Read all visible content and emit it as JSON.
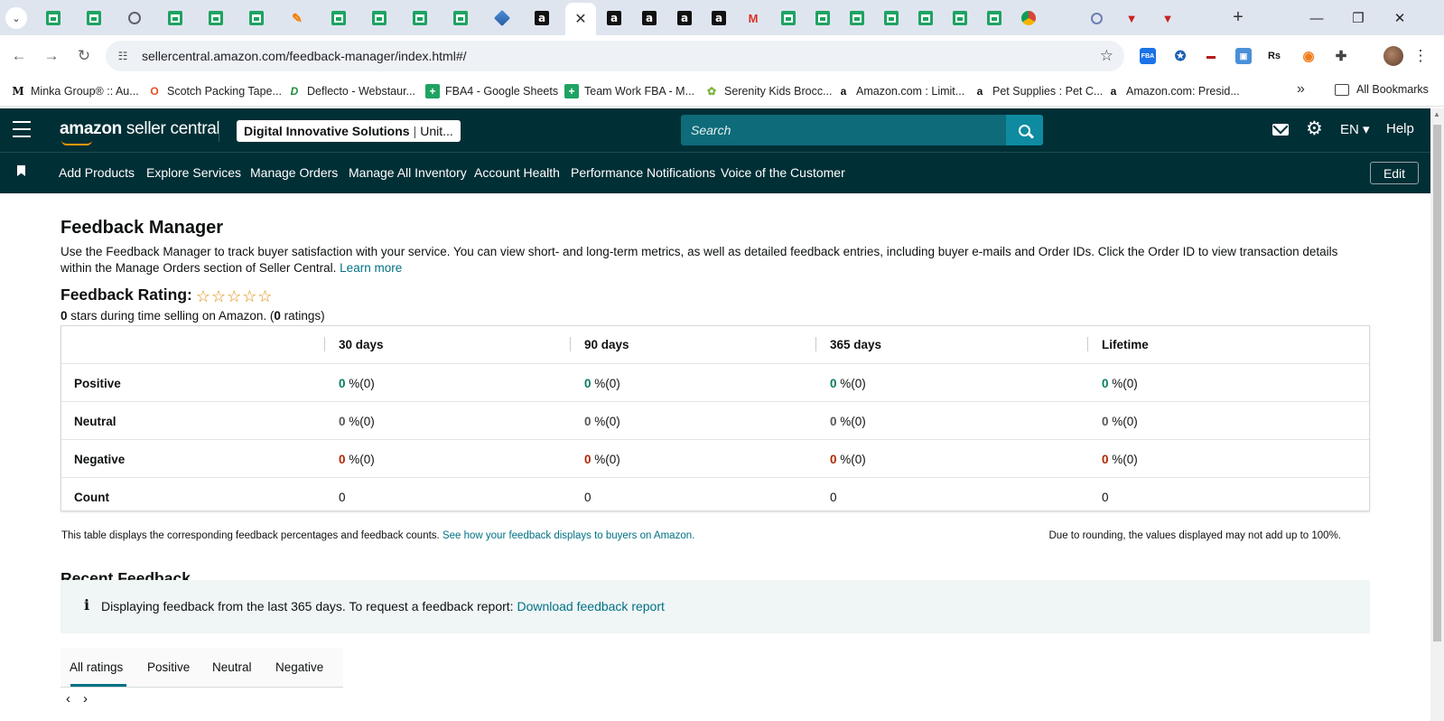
{
  "browser": {
    "tab_icons": [
      "sheets-icon",
      "sheets-icon",
      "globe-icon",
      "sheets-icon",
      "sheets-icon",
      "sheets-icon",
      "pen-icon",
      "sheets-icon",
      "sheets-icon",
      "sheets-icon",
      "sheets-icon",
      "cube-icon",
      "amazon-icon",
      "amazon-icon",
      "amazon-icon",
      "amazon-icon",
      "amazon-icon",
      "gmail-icon",
      "sheets-icon",
      "sheets-icon",
      "sheets-icon",
      "sheets-icon",
      "sheets-icon",
      "sheets-icon",
      "sheets-icon",
      "chrome-icon",
      "blank-icon",
      "ring-icon",
      "red-v-icon",
      "red-v-icon"
    ],
    "active_tab_close": "✕",
    "new_tab": "+",
    "url": "sellercentral.amazon.com/feedback-manager/index.html#/",
    "window_controls": {
      "minimize": "—",
      "restore": "❐",
      "close": "✕"
    },
    "extensions": [
      "FBA",
      "✪",
      "▬",
      "▣",
      "Rs",
      "◉",
      "✚"
    ]
  },
  "bookmarks": [
    {
      "icon": "M",
      "label": "Minka Group® :: Au..."
    },
    {
      "icon": "O",
      "label": "Scotch Packing Tape..."
    },
    {
      "icon": "D",
      "label": "Deflecto - Webstaur..."
    },
    {
      "icon": "+",
      "label": "FBA4 - Google Sheets"
    },
    {
      "icon": "+",
      "label": "Team Work FBA - M..."
    },
    {
      "icon": "✿",
      "label": "Serenity Kids Brocc..."
    },
    {
      "icon": "a",
      "label": "Amazon.com : Limit..."
    },
    {
      "icon": "a",
      "label": "Pet Supplies : Pet C..."
    },
    {
      "icon": "a",
      "label": "Amazon.com: Presid..."
    }
  ],
  "bookmarks_overflow": "»",
  "all_bookmarks": "All Bookmarks",
  "header": {
    "logo_bold": "amazon",
    "logo_rest": " seller central",
    "account_name": "Digital Innovative Solutions",
    "account_region": "Unit...",
    "search_placeholder": "Search",
    "language": "EN ▾",
    "help": "Help",
    "settings_glyph": "⚙"
  },
  "nav": {
    "links": [
      "Add Products",
      "Explore Services",
      "Manage Orders",
      "Manage All Inventory",
      "Account Health",
      "Performance Notifications",
      "Voice of the Customer"
    ],
    "edit": "Edit"
  },
  "page": {
    "title": "Feedback Manager",
    "description": "Use the Feedback Manager to track buyer satisfaction with your service. You can view short- and long-term metrics, as well as detailed feedback entries, including buyer e-mails and Order IDs. Click the Order ID to view transaction details within the Manage Orders section of Seller Central.",
    "learn_more": "Learn more",
    "rating_label": "Feedback Rating:",
    "stars": "☆☆☆☆☆",
    "rating_stars": "0",
    "rating_text_mid": " stars during time selling on Amazon. (",
    "rating_count": "0",
    "rating_text_end": " ratings)"
  },
  "feedback_table": {
    "columns": [
      "30 days",
      "90 days",
      "365 days",
      "Lifetime"
    ],
    "rows": [
      {
        "label": "Positive",
        "kind": "pos",
        "cells": [
          {
            "pct": "0",
            "suffix": " %(0)"
          },
          {
            "pct": "0",
            "suffix": " %(0)"
          },
          {
            "pct": "0",
            "suffix": " %(0)"
          },
          {
            "pct": "0",
            "suffix": " %(0)"
          }
        ]
      },
      {
        "label": "Neutral",
        "kind": "neu",
        "cells": [
          {
            "pct": "0",
            "suffix": " %(0)"
          },
          {
            "pct": "0",
            "suffix": " %(0)"
          },
          {
            "pct": "0",
            "suffix": " %(0)"
          },
          {
            "pct": "0",
            "suffix": " %(0)"
          }
        ]
      },
      {
        "label": "Negative",
        "kind": "neg",
        "cells": [
          {
            "pct": "0",
            "suffix": " %(0)"
          },
          {
            "pct": "0",
            "suffix": " %(0)"
          },
          {
            "pct": "0",
            "suffix": " %(0)"
          },
          {
            "pct": "0",
            "suffix": " %(0)"
          }
        ]
      },
      {
        "label": "Count",
        "kind": "count",
        "cells": [
          {
            "pct": "",
            "suffix": "0"
          },
          {
            "pct": "",
            "suffix": "0"
          },
          {
            "pct": "",
            "suffix": "0"
          },
          {
            "pct": "",
            "suffix": "0"
          }
        ]
      }
    ],
    "note": "This table displays the corresponding feedback percentages and feedback counts.",
    "note_link": "See how your feedback displays to buyers on Amazon.",
    "rounding_note": "Due to rounding, the values displayed may not add up to 100%."
  },
  "recent": {
    "title": "Recent Feedback",
    "info_icon": "i",
    "info_text": "Displaying feedback from the last 365 days. To request a feedback report:",
    "info_link": "Download feedback report",
    "tabs": [
      "All ratings",
      "Positive",
      "Neutral",
      "Negative"
    ],
    "pager_prev": "‹",
    "pager_next": "›"
  },
  "colors": {
    "header_bg": "#002f36",
    "link": "#007185",
    "positive": "#067d62",
    "negative": "#b12704",
    "star": "#e08a00"
  }
}
